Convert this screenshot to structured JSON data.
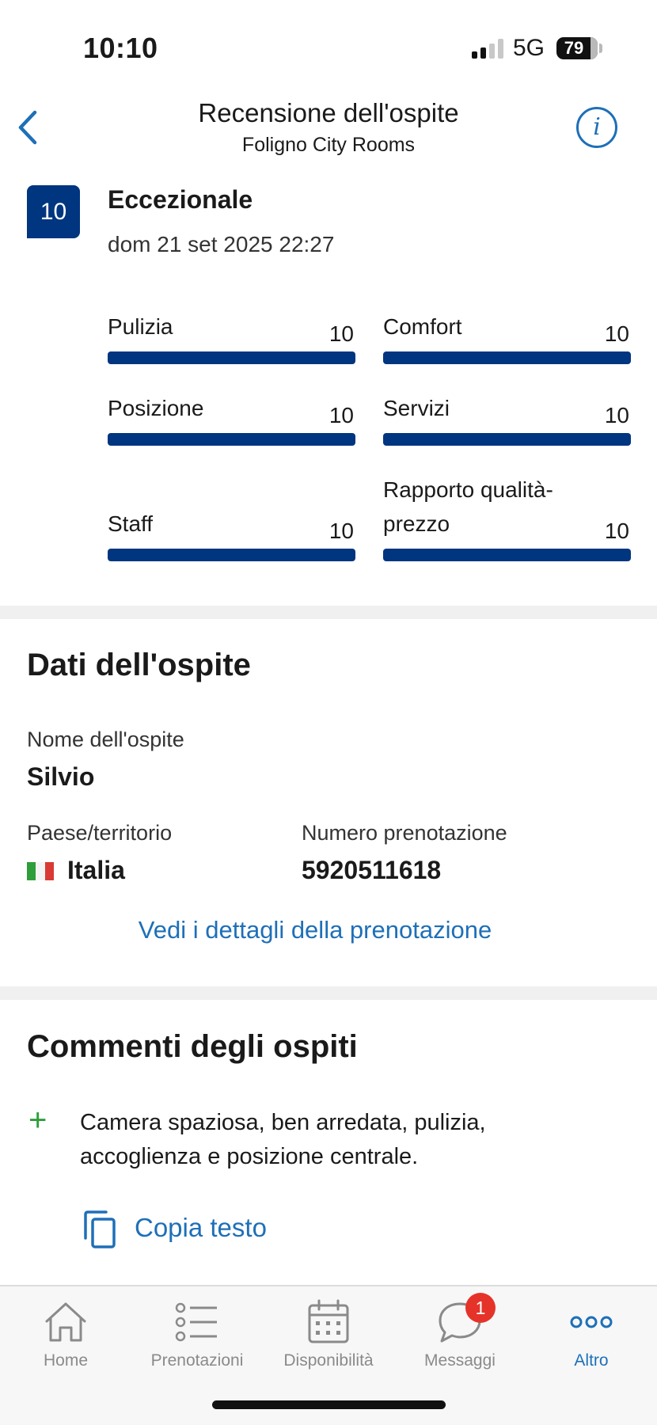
{
  "status_bar": {
    "time": "10:10",
    "network": "5G",
    "battery": "79"
  },
  "header": {
    "title": "Recensione dell'ospite",
    "subtitle": "Foligno City Rooms"
  },
  "review": {
    "score": "10",
    "score_word": "Eccezionale",
    "date": "dom 21 set 2025 22:27",
    "categories": [
      {
        "label": "Pulizia",
        "value": "10"
      },
      {
        "label": "Comfort",
        "value": "10"
      },
      {
        "label": "Posizione",
        "value": "10"
      },
      {
        "label": "Servizi",
        "value": "10"
      },
      {
        "label": "Staff",
        "value": "10"
      },
      {
        "label": "Rapporto qualità-prezzo",
        "value": "10"
      }
    ]
  },
  "guest": {
    "section_title": "Dati dell'ospite",
    "name_label": "Nome dell'ospite",
    "name": "Silvio",
    "country_label": "Paese/territorio",
    "country": "Italia",
    "booking_label": "Numero prenotazione",
    "booking_number": "5920511618",
    "details_link": "Vedi i dettagli della prenotazione"
  },
  "comments": {
    "section_title": "Commenti degli ospiti",
    "positive_text": "Camera spaziosa, ben arredata, pulizia, accoglienza e posizione centrale.",
    "copy_label": "Copia testo"
  },
  "tabbar": {
    "tabs": [
      {
        "label": "Home",
        "icon": "home-icon"
      },
      {
        "label": "Prenotazioni",
        "icon": "list-icon"
      },
      {
        "label": "Disponibilità",
        "icon": "calendar-icon"
      },
      {
        "label": "Messaggi",
        "icon": "chat-bubble-icon",
        "badge": "1"
      },
      {
        "label": "Altro",
        "icon": "more-dots-icon",
        "active": true
      }
    ]
  },
  "colors": {
    "brand_navy": "#003580",
    "link_blue": "#1e6fb8",
    "positive_green": "#2e9e3a",
    "badge_red": "#e5332a"
  }
}
